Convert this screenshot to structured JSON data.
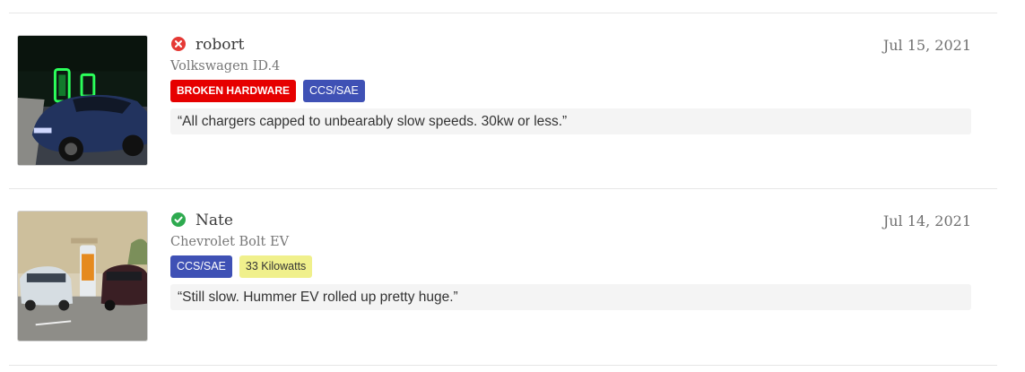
{
  "checkins": [
    {
      "status": "failure",
      "status_color": "#e53935",
      "status_icon": "x-circle-icon",
      "user": "robort",
      "vehicle": "Volkswagen ID.4",
      "date": "Jul 15, 2021",
      "tags": [
        {
          "label": "BROKEN HARDWARE",
          "kind": "problem",
          "color": "#e60000"
        },
        {
          "label": "CCS/SAE",
          "kind": "plug",
          "color": "#3f51b5"
        }
      ],
      "comment": "“All chargers capped to unbearably slow speeds. 30kw or less.”",
      "photo": "night-charging-station-photo"
    },
    {
      "status": "success",
      "status_color": "#2eaa4f",
      "status_icon": "check-circle-icon",
      "user": "Nate",
      "vehicle": "Chevrolet Bolt EV",
      "date": "Jul 14, 2021",
      "tags": [
        {
          "label": "CCS/SAE",
          "kind": "plug",
          "color": "#3f51b5"
        },
        {
          "label": "33 Kilowatts",
          "kind": "power",
          "color": "#f0f08c"
        }
      ],
      "comment": "“Still slow. Hummer EV rolled up pretty huge.”",
      "photo": "daytime-charging-station-photo"
    }
  ]
}
